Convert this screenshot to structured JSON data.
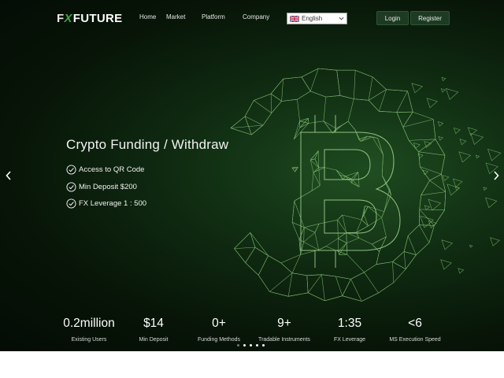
{
  "brand": {
    "logo_prefix": "F",
    "logo_mark": "X",
    "logo_text": "FUTURE"
  },
  "nav": {
    "home": "Home",
    "market": "Market",
    "platform": "Platform",
    "company": "Company"
  },
  "language": {
    "selected": "English",
    "flag_icon": "uk-flag-icon",
    "chevron_icon": "chevron-down-icon"
  },
  "auth": {
    "login": "Login",
    "register": "Register"
  },
  "hero": {
    "title": "Crypto Funding / Withdraw",
    "features": [
      "Access to QR Code",
      "Min Deposit $200",
      "FX Leverage 1 : 500"
    ],
    "feature_icon": "check-circle-icon",
    "background_icon": "bitcoin-network-icon",
    "prev_icon": "chevron-left-icon",
    "next_icon": "chevron-right-icon"
  },
  "stats": [
    {
      "value": "0.2million",
      "label": "Existing Users"
    },
    {
      "value": "$14",
      "label": "Min Deposit"
    },
    {
      "value": "0+",
      "label": "Funding Methods"
    },
    {
      "value": "9+",
      "label": "Tradable Instruments"
    },
    {
      "value": "1:35",
      "label": "FX Leverage"
    },
    {
      "value": "<6",
      "label": "MS Execution Speed"
    }
  ],
  "carousel": {
    "slide_count": 5,
    "active_index": 4
  },
  "colors": {
    "brand_green": "#3da83f",
    "button_bg": "#1d3a22",
    "line_green": "#9fd08f"
  }
}
